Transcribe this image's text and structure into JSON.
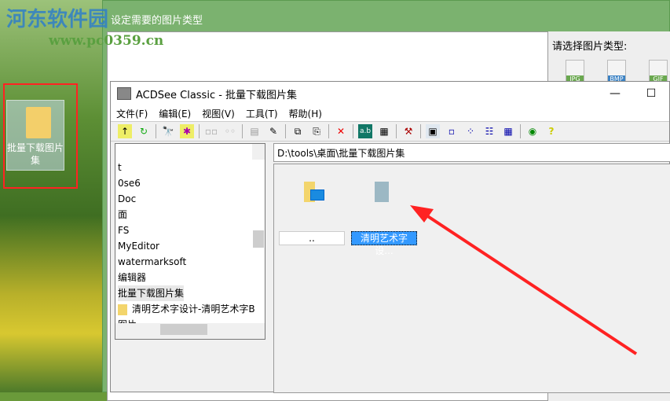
{
  "watermark": {
    "name": "河东软件园",
    "url": "www.pc0359.cn"
  },
  "desktop": {
    "icon_label": "批量下载图片集"
  },
  "back_window": {
    "title": "设定需要的图片类型",
    "panel_label": "请选择图片类型:",
    "types": [
      "JPG",
      "BMP",
      "GIF"
    ]
  },
  "acdsee": {
    "title": "ACDSee Classic - 批量下载图片集",
    "minimize": "—",
    "maximize": "☐",
    "menu": [
      "文件(F)",
      "编辑(E)",
      "视图(V)",
      "工具(T)",
      "帮助(H)"
    ],
    "tree": [
      "t",
      "0se6",
      "Doc",
      "面",
      "FS",
      "MyEditor",
      "watermarksoft",
      "编辑器",
      "批量下载图片集",
      "清明艺术字设计-清明艺术字B",
      "图片"
    ],
    "address": "D:\\tools\\桌面\\批量下载图片集",
    "files": [
      "..",
      "清明艺术字设..."
    ]
  },
  "colors": {
    "annotation": "#f22222",
    "selection": "#3399ff"
  }
}
